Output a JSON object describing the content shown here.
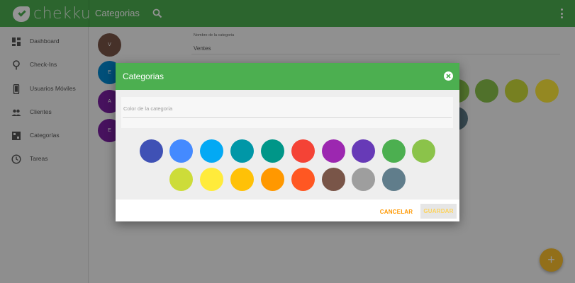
{
  "app": {
    "logo_text": "chekku",
    "title": "Categorias"
  },
  "icons": {
    "search": "search-icon",
    "more": "more-vert-icon",
    "close": "close-circle-icon",
    "add": "plus-icon"
  },
  "sidebar": {
    "items": [
      {
        "label": "Dashboard",
        "icon": "dashboard-icon"
      },
      {
        "label": "Check-Ins",
        "icon": "pin-icon"
      },
      {
        "label": "Usuarios Móviles",
        "icon": "phone-icon"
      },
      {
        "label": "Clientes",
        "icon": "people-icon"
      },
      {
        "label": "Categorías",
        "icon": "category-icon"
      },
      {
        "label": "Tareas",
        "icon": "clock-icon"
      }
    ]
  },
  "main": {
    "avatars": [
      {
        "letter": "V",
        "color": "#795548"
      },
      {
        "letter": "E",
        "color": "#0288d1"
      },
      {
        "letter": "A",
        "color": "#7b1fa2"
      },
      {
        "letter": "E",
        "color": "#7b1fa2"
      }
    ],
    "category_name_label": "Nombre de la categoria",
    "category_name_value": "Ventes",
    "background_swatches": [
      "#8bc34a",
      "#8bc34a",
      "#cddc39",
      "#ffeb3b",
      "#607d8b"
    ],
    "fab_label": "+"
  },
  "dialog": {
    "title": "Categorias",
    "color_field_placeholder": "Color de la categoria",
    "colors": [
      "#3f51b5",
      "#448aff",
      "#03a9f4",
      "#0097a7",
      "#009688",
      "#f44336",
      "#9c27b0",
      "#673ab7",
      "#4caf50",
      "#8bc34a",
      "#cddc39",
      "#ffeb3b",
      "#ffc107",
      "#ff9800",
      "#ff5722",
      "#795548",
      "#9e9e9e",
      "#607d8b"
    ],
    "cancel_label": "CANCELAR",
    "save_label": "GUARDAR"
  },
  "theme": {
    "primary": "#4caf50",
    "accent": "#ff9800"
  }
}
